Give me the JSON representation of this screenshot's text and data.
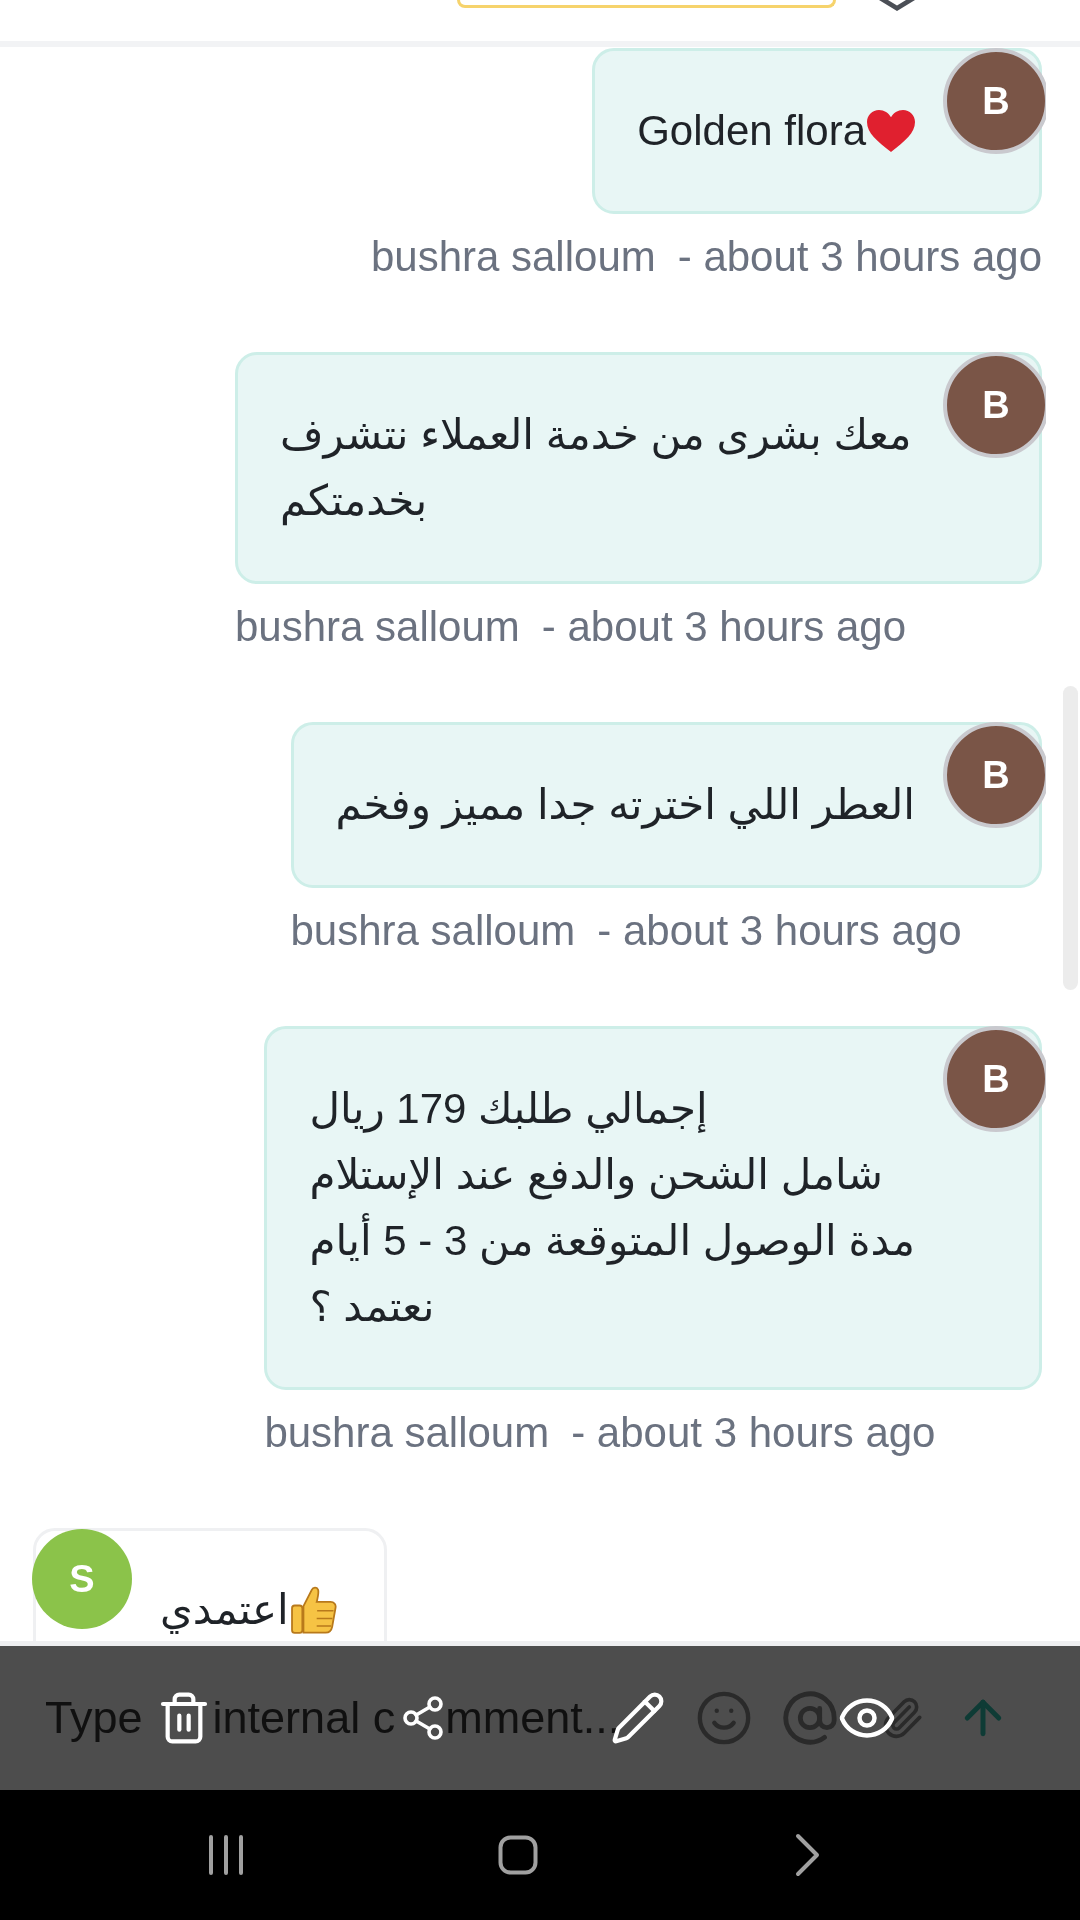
{
  "messages": [
    {
      "kind": "outgoing",
      "avatar": "B",
      "color": "#7a5547",
      "text": "Golden flora",
      "emoji": {
        "kind": "heart"
      },
      "author": "bushra salloum",
      "time": "- about 3 hours ago"
    },
    {
      "kind": "outgoing",
      "avatar": "B",
      "color": "#7a5547",
      "text": "معك بشرى من خدمة العملاء نتشرف بخدمتكم",
      "author": "bushra salloum",
      "time": "- about 3 hours ago"
    },
    {
      "kind": "outgoing",
      "avatar": "B",
      "color": "#7a5547",
      "text": "العطر اللي اخترته جدا مميز وفخم",
      "author": "bushra salloum",
      "time": "- about 3 hours ago"
    },
    {
      "kind": "outgoing",
      "avatar": "B",
      "color": "#7a5547",
      "text": "إجمالي طلبك 179 ريال\nشامل الشحن والدفع عند الإستلام\nمدة الوصول المتوقعة من 3 - 5 أيام\nنعتمد ؟",
      "author": "bushra salloum",
      "time": "- about 3 hours ago"
    },
    {
      "kind": "incoming",
      "avatar": "S",
      "color": "#8bc34a",
      "text": "اعتمدي",
      "emoji": {
        "kind": "thumbs_up"
      }
    }
  ],
  "composer": {
    "placeholder": {
      "start": "Type",
      "middle": "internal c",
      "end": "mment..."
    }
  }
}
